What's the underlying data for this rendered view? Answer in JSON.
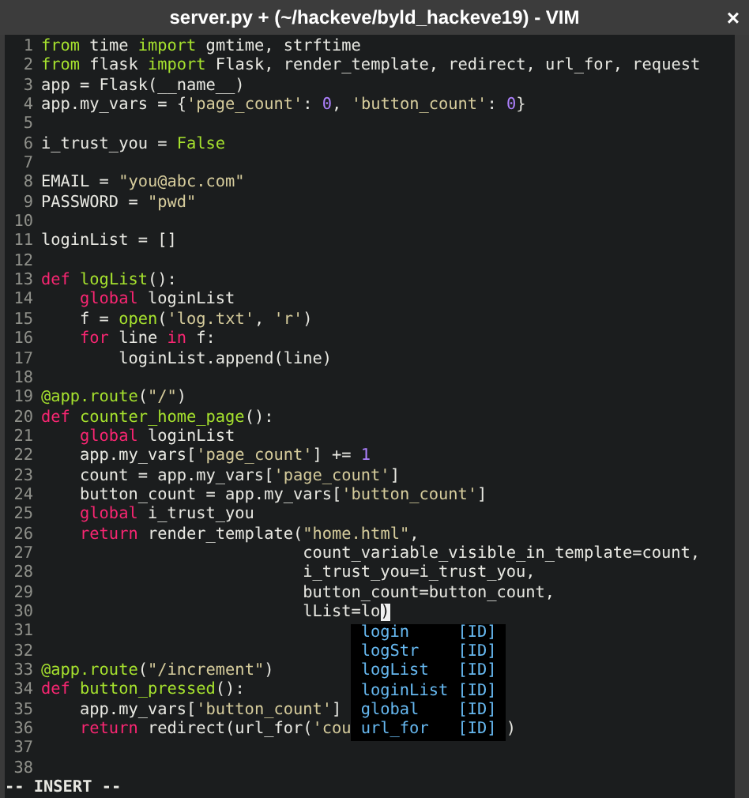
{
  "window": {
    "title": "server.py + (~/hackeve/byld_hackeve19) - VIM",
    "close": "×"
  },
  "editor": {
    "lines": [
      {
        "number": "1",
        "tokens": [
          {
            "text": "from",
            "kind": "builtin"
          },
          {
            "text": " time ",
            "kind": "plain"
          },
          {
            "text": "import",
            "kind": "builtin"
          },
          {
            "text": " gmtime, strftime",
            "kind": "plain"
          }
        ]
      },
      {
        "number": "2",
        "tokens": [
          {
            "text": "from",
            "kind": "builtin"
          },
          {
            "text": " flask ",
            "kind": "plain"
          },
          {
            "text": "import",
            "kind": "builtin"
          },
          {
            "text": " Flask, render_template, redirect, url_for, request",
            "kind": "plain"
          }
        ]
      },
      {
        "number": "3",
        "tokens": [
          {
            "text": "app = Flask(__name__)",
            "kind": "plain"
          }
        ]
      },
      {
        "number": "4",
        "tokens": [
          {
            "text": "app.my_vars = {",
            "kind": "plain"
          },
          {
            "text": "'page_count'",
            "kind": "string"
          },
          {
            "text": ": ",
            "kind": "plain"
          },
          {
            "text": "0",
            "kind": "number"
          },
          {
            "text": ", ",
            "kind": "plain"
          },
          {
            "text": "'button_count'",
            "kind": "string"
          },
          {
            "text": ": ",
            "kind": "plain"
          },
          {
            "text": "0",
            "kind": "number"
          },
          {
            "text": "}",
            "kind": "plain"
          }
        ]
      },
      {
        "number": "5"
      },
      {
        "number": "6",
        "tokens": [
          {
            "text": "i_trust_you = ",
            "kind": "plain"
          },
          {
            "text": "False",
            "kind": "builtin"
          }
        ]
      },
      {
        "number": "7"
      },
      {
        "number": "8",
        "tokens": [
          {
            "text": "EMAIL = ",
            "kind": "plain"
          },
          {
            "text": "\"you@abc.com\"",
            "kind": "string"
          }
        ]
      },
      {
        "number": "9",
        "tokens": [
          {
            "text": "PASSWORD = ",
            "kind": "plain"
          },
          {
            "text": "\"pwd\"",
            "kind": "string"
          }
        ]
      },
      {
        "number": "10"
      },
      {
        "number": "11",
        "tokens": [
          {
            "text": "loginList = []",
            "kind": "plain"
          }
        ]
      },
      {
        "number": "12"
      },
      {
        "number": "13",
        "tokens": [
          {
            "text": "def",
            "kind": "keyword"
          },
          {
            "text": " logList",
            "kind": "builtin"
          },
          {
            "text": "():",
            "kind": "plain"
          }
        ]
      },
      {
        "number": "14",
        "tokens": [
          {
            "text": "    global",
            "kind": "keyword"
          },
          {
            "text": " loginList",
            "kind": "plain"
          }
        ]
      },
      {
        "number": "15",
        "tokens": [
          {
            "text": "    f = ",
            "kind": "plain"
          },
          {
            "text": "open",
            "kind": "builtin"
          },
          {
            "text": "(",
            "kind": "plain"
          },
          {
            "text": "'log.txt'",
            "kind": "string"
          },
          {
            "text": ", ",
            "kind": "plain"
          },
          {
            "text": "'r'",
            "kind": "string"
          },
          {
            "text": ")",
            "kind": "plain"
          }
        ]
      },
      {
        "number": "16",
        "tokens": [
          {
            "text": "    for",
            "kind": "keyword"
          },
          {
            "text": " line ",
            "kind": "plain"
          },
          {
            "text": "in",
            "kind": "keyword"
          },
          {
            "text": " f:",
            "kind": "plain"
          }
        ]
      },
      {
        "number": "17",
        "tokens": [
          {
            "text": "        loginList.append(line)",
            "kind": "plain"
          }
        ]
      },
      {
        "number": "18"
      },
      {
        "number": "19",
        "tokens": [
          {
            "text": "@app.route",
            "kind": "builtin"
          },
          {
            "text": "(",
            "kind": "plain"
          },
          {
            "text": "\"/\"",
            "kind": "string"
          },
          {
            "text": ")",
            "kind": "plain"
          }
        ]
      },
      {
        "number": "20",
        "tokens": [
          {
            "text": "def",
            "kind": "keyword"
          },
          {
            "text": " counter_home_page",
            "kind": "builtin"
          },
          {
            "text": "():",
            "kind": "plain"
          }
        ]
      },
      {
        "number": "21",
        "tokens": [
          {
            "text": "    global",
            "kind": "keyword"
          },
          {
            "text": " loginList",
            "kind": "plain"
          }
        ]
      },
      {
        "number": "22",
        "tokens": [
          {
            "text": "    app.my_vars[",
            "kind": "plain"
          },
          {
            "text": "'page_count'",
            "kind": "string"
          },
          {
            "text": "] += ",
            "kind": "plain"
          },
          {
            "text": "1",
            "kind": "number"
          }
        ]
      },
      {
        "number": "23",
        "tokens": [
          {
            "text": "    count = app.my_vars[",
            "kind": "plain"
          },
          {
            "text": "'page_count'",
            "kind": "string"
          },
          {
            "text": "]",
            "kind": "plain"
          }
        ]
      },
      {
        "number": "24",
        "tokens": [
          {
            "text": "    button_count = app.my_vars[",
            "kind": "plain"
          },
          {
            "text": "'button_count'",
            "kind": "string"
          },
          {
            "text": "]",
            "kind": "plain"
          }
        ]
      },
      {
        "number": "25",
        "tokens": [
          {
            "text": "    global",
            "kind": "keyword"
          },
          {
            "text": " i_trust_you",
            "kind": "plain"
          }
        ]
      },
      {
        "number": "26",
        "tokens": [
          {
            "text": "    return",
            "kind": "keyword"
          },
          {
            "text": " render_template(",
            "kind": "plain"
          },
          {
            "text": "\"home.html\"",
            "kind": "string"
          },
          {
            "text": ",",
            "kind": "plain"
          }
        ]
      },
      {
        "number": "27",
        "tokens": [
          {
            "text": "                           count_variable_visible_in_template=count,",
            "kind": "plain"
          }
        ]
      },
      {
        "number": "28",
        "tokens": [
          {
            "text": "                           i_trust_you=i_trust_you,",
            "kind": "plain"
          }
        ]
      },
      {
        "number": "29",
        "tokens": [
          {
            "text": "                           button_count=button_count,",
            "kind": "plain"
          }
        ]
      },
      {
        "number": "30",
        "tokens": [
          {
            "text": "                           lList=lo",
            "kind": "plain"
          },
          {
            "text": ")",
            "kind": "cursor"
          }
        ]
      },
      {
        "number": "31"
      },
      {
        "number": "32"
      },
      {
        "number": "33",
        "tokens": [
          {
            "text": "@app.route",
            "kind": "builtin"
          },
          {
            "text": "(",
            "kind": "plain"
          },
          {
            "text": "\"/increment\"",
            "kind": "string"
          },
          {
            "text": ")",
            "kind": "plain"
          }
        ]
      },
      {
        "number": "34",
        "tokens": [
          {
            "text": "def",
            "kind": "keyword"
          },
          {
            "text": " button_pressed",
            "kind": "builtin"
          },
          {
            "text": "():",
            "kind": "plain"
          }
        ]
      },
      {
        "number": "35",
        "tokens": [
          {
            "text": "    app.my_vars[",
            "kind": "plain"
          },
          {
            "text": "'button_count'",
            "kind": "string"
          },
          {
            "text": "]",
            "kind": "plain"
          }
        ]
      },
      {
        "number": "36",
        "tokens": [
          {
            "text": "    return",
            "kind": "keyword"
          },
          {
            "text": " redirect(url_for(",
            "kind": "plain"
          },
          {
            "text": "'cou",
            "kind": "string"
          }
        ],
        "tail": ")"
      },
      {
        "number": "37"
      },
      {
        "number": "38"
      }
    ],
    "completion_menu": {
      "items": [
        {
          "word": "login",
          "tag": "[ID]",
          "selected": false
        },
        {
          "word": "logStr",
          "tag": "[ID]",
          "selected": false
        },
        {
          "word": "logList",
          "tag": "[ID]",
          "selected": false
        },
        {
          "word": "loginList",
          "tag": "[ID]",
          "selected": false
        },
        {
          "word": "global",
          "tag": "[ID]",
          "selected": false
        },
        {
          "word": "url_for",
          "tag": "[ID]",
          "selected": false
        }
      ]
    }
  },
  "status_line": "-- INSERT --"
}
